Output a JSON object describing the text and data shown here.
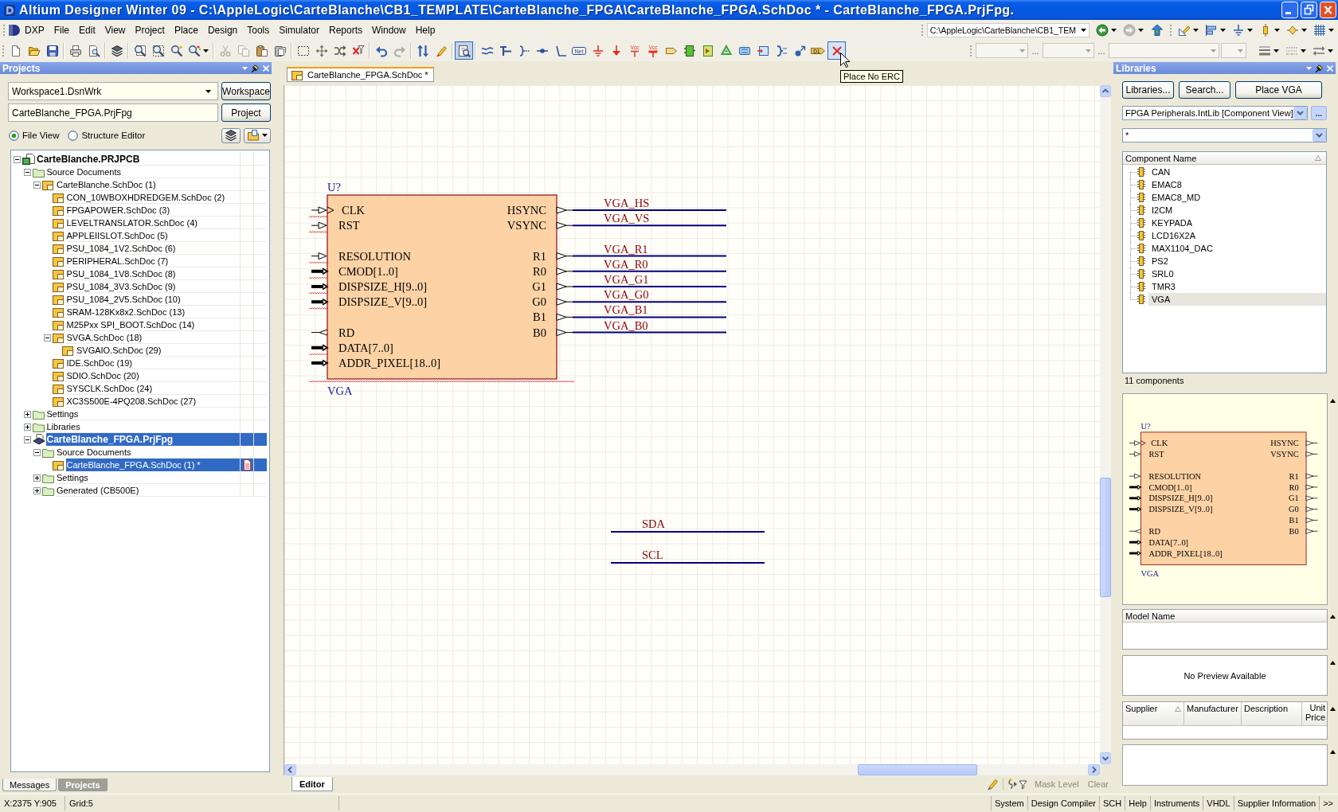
{
  "window": {
    "title": "Altium Designer Winter 09 - C:\\AppleLogic\\CarteBlanche\\CB1_TEMPLATE\\CarteBlanche_FPGA\\CarteBlanche_FPGA.SchDoc * - CarteBlanche_FPGA.PrjFpg."
  },
  "menu": {
    "items": [
      "DXP",
      "File",
      "Edit",
      "View",
      "Project",
      "Place",
      "Design",
      "Tools",
      "Simulator",
      "Reports",
      "Window",
      "Help"
    ],
    "path": "C:\\AppleLogic\\CarteBlanche\\CB1_TEM",
    "navigation": [
      {
        "kind": "back"
      },
      {
        "kind": "forward",
        "disabled": true
      },
      {
        "kind": "up"
      }
    ],
    "tools": [
      {
        "kind": "ruler"
      },
      {
        "kind": "align"
      },
      {
        "kind": "gnd"
      },
      {
        "kind": "resistor"
      },
      {
        "kind": "diamond"
      },
      {
        "kind": "grid"
      }
    ]
  },
  "toolbar": {
    "groups": [
      [
        {
          "kind": "new"
        },
        {
          "kind": "open"
        },
        {
          "kind": "save"
        }
      ],
      [
        {
          "kind": "print"
        },
        {
          "kind": "preview"
        }
      ],
      [
        {
          "kind": "layers"
        }
      ],
      [
        {
          "kind": "zoomfit"
        },
        {
          "kind": "zoomarea"
        },
        {
          "kind": "zoomselect"
        },
        {
          "kind": "zoomfilter"
        }
      ],
      [
        {
          "kind": "cut",
          "disabled": true
        },
        {
          "kind": "copy",
          "disabled": true
        },
        {
          "kind": "paste"
        },
        {
          "kind": "stamp"
        }
      ],
      [
        {
          "kind": "select"
        },
        {
          "kind": "move"
        },
        {
          "kind": "drag"
        },
        {
          "kind": "clearfilter"
        }
      ],
      [
        {
          "kind": "undo"
        },
        {
          "kind": "redo",
          "disabled": true
        }
      ],
      [
        {
          "kind": "updown"
        },
        {
          "kind": "marker"
        }
      ],
      [
        {
          "kind": "crossprobe",
          "pressed": true
        }
      ],
      [
        {
          "kind": "wire"
        },
        {
          "kind": "bus"
        },
        {
          "kind": "busentry"
        },
        {
          "kind": "junction"
        },
        {
          "kind": "bent"
        },
        {
          "kind": "netlabel",
          "text": "Net"
        },
        {
          "kind": "ground"
        },
        {
          "kind": "power"
        },
        {
          "kind": "vcc",
          "text": "Vcc"
        },
        {
          "kind": "vccbar",
          "text": "Vcc"
        },
        {
          "kind": "port"
        },
        {
          "kind": "sheet"
        },
        {
          "kind": "sheetentry"
        },
        {
          "kind": "devicesheet"
        },
        {
          "kind": "harnessconn"
        },
        {
          "kind": "harnessentry"
        },
        {
          "kind": "bracket"
        },
        {
          "kind": "sigharness"
        },
        {
          "kind": "part",
          "text": "D1"
        },
        {
          "kind": "noerc",
          "hovered": true
        }
      ]
    ],
    "format": [
      {
        "kind": "combo"
      },
      {
        "kind": "dots",
        "text": "..."
      },
      {
        "kind": "combo"
      },
      {
        "kind": "dots",
        "text": "..."
      },
      {
        "kind": "combo"
      },
      {
        "kind": "combo"
      }
    ],
    "format_tools": [
      {
        "kind": "linewidth"
      },
      {
        "kind": "linestyle"
      },
      {
        "kind": "arrows"
      }
    ]
  },
  "tooltip": {
    "text": "Place No ERC"
  },
  "projects_panel": {
    "title": "Projects",
    "workspace": "Workspace1.DsnWrk",
    "workspace_button": "Workspace",
    "project": "CarteBlanche_FPGA.PrjFpg",
    "project_button": "Project",
    "views": [
      {
        "label": "File View",
        "selected": true
      },
      {
        "label": "Structure Editor",
        "selected": false
      }
    ],
    "tree": [
      {
        "label": "CarteBlanche.PRJPCB",
        "kind": "pcbproject",
        "expanded": true,
        "selected": false,
        "children": [
          {
            "label": "Source Documents",
            "kind": "folder",
            "expanded": true,
            "selected": false,
            "children": [
              {
                "label": "CarteBlanche.SchDoc (1)",
                "kind": "schdoc",
                "expanded": true,
                "selected": false,
                "children": [
                  {
                    "label": "CON_10WBOXHDREDGEM.SchDoc (2)",
                    "kind": "schdoc",
                    "selected": false
                  },
                  {
                    "label": "FPGAPOWER.SchDoc (3)",
                    "kind": "schdoc",
                    "selected": false
                  },
                  {
                    "label": "LEVELTRANSLATOR.SchDoc (4)",
                    "kind": "schdoc",
                    "selected": false
                  },
                  {
                    "label": "APPLEIISLOT.SchDoc (5)",
                    "kind": "schdoc",
                    "selected": false
                  },
                  {
                    "label": "PSU_1084_1V2.SchDoc (6)",
                    "kind": "schdoc",
                    "selected": false
                  },
                  {
                    "label": "PERIPHERAL.SchDoc (7)",
                    "kind": "schdoc",
                    "selected": false
                  },
                  {
                    "label": "PSU_1084_1V8.SchDoc (8)",
                    "kind": "schdoc",
                    "selected": false
                  },
                  {
                    "label": "PSU_1084_3V3.SchDoc (9)",
                    "kind": "schdoc",
                    "selected": false
                  },
                  {
                    "label": "PSU_1084_2V5.SchDoc (10)",
                    "kind": "schdoc",
                    "selected": false
                  },
                  {
                    "label": "SRAM-128Kx8x2.SchDoc (13)",
                    "kind": "schdoc",
                    "selected": false
                  },
                  {
                    "label": "M25Pxx SPI_BOOT.SchDoc (14)",
                    "kind": "schdoc",
                    "selected": false
                  },
                  {
                    "label": "SVGA.SchDoc (18)",
                    "kind": "schdoc",
                    "expanded": true,
                    "selected": false,
                    "children": [
                      {
                        "label": "SVGAIO.SchDoc (29)",
                        "kind": "schdoc",
                        "selected": false
                      }
                    ]
                  },
                  {
                    "label": "IDE.SchDoc (19)",
                    "kind": "schdoc",
                    "selected": false
                  },
                  {
                    "label": "SDIO.SchDoc (20)",
                    "kind": "schdoc",
                    "selected": false
                  },
                  {
                    "label": "SYSCLK.SchDoc (24)",
                    "kind": "schdoc",
                    "selected": false
                  },
                  {
                    "label": "XC3S500E-4PQ208.SchDoc (27)",
                    "kind": "schdoc",
                    "selected": false
                  }
                ]
              }
            ]
          },
          {
            "label": "Settings",
            "kind": "folder",
            "expanded": false,
            "selected": false
          },
          {
            "label": "Libraries",
            "kind": "folder",
            "expanded": false,
            "selected": false
          },
          {
            "label": "CarteBlanche_FPGA.PrjFpg",
            "kind": "fpgaproject",
            "expanded": true,
            "selected": true,
            "children": [
              {
                "label": "Source Documents",
                "kind": "folder",
                "expanded": true,
                "selected": false,
                "children": [
                  {
                    "label": "CarteBlanche_FPGA.SchDoc (1) *",
                    "kind": "schdoc",
                    "selected": true,
                    "modified": true
                  }
                ]
              },
              {
                "label": "Settings",
                "kind": "folder",
                "expanded": false,
                "selected": false
              },
              {
                "label": "Generated (CB500E)",
                "kind": "folder",
                "expanded": false,
                "selected": false
              }
            ]
          }
        ]
      }
    ],
    "tabs": [
      {
        "label": "Messages",
        "selected": false
      },
      {
        "label": "Projects",
        "selected": true
      }
    ]
  },
  "document": {
    "tabs": [
      {
        "label": "CarteBlanche_FPGA.SchDoc *",
        "selected": true
      }
    ],
    "editor_tabs": [
      {
        "label": "Editor",
        "selected": true
      }
    ],
    "mask_buttons": [
      {
        "label": "Mask Level",
        "disabled": true
      },
      {
        "label": "Clear",
        "disabled": true
      }
    ]
  },
  "schematic": {
    "symbol": {
      "designator": "U?",
      "comment": "VGA",
      "error": true,
      "left_groups": [
        [
          {
            "name": "CLK",
            "kind": "clock",
            "error": true
          },
          {
            "name": "RST",
            "kind": "input",
            "error": true
          }
        ],
        [
          {
            "name": "RESOLUTION",
            "kind": "input",
            "error": true
          },
          {
            "name": "CMOD[1..0]",
            "kind": "bus",
            "error": true
          },
          {
            "name": "DISPSIZE_H[9..0]",
            "kind": "bus",
            "error": true
          },
          {
            "name": "DISPSIZE_V[9..0]",
            "kind": "bus",
            "error": true
          }
        ],
        [
          {
            "name": "RD",
            "kind": "output"
          },
          {
            "name": "DATA[7..0]",
            "kind": "bus",
            "error": true
          },
          {
            "name": "ADDR_PIXEL[18..0]",
            "kind": "bus"
          }
        ]
      ],
      "right_groups": [
        [
          {
            "name": "HSYNC",
            "kind": "output",
            "net": "VGA_HS"
          },
          {
            "name": "VSYNC",
            "kind": "output",
            "net": "VGA_VS"
          }
        ],
        [
          {
            "name": "R1",
            "kind": "output",
            "net": "VGA_R1"
          },
          {
            "name": "R0",
            "kind": "output",
            "net": "VGA_R0"
          },
          {
            "name": "G1",
            "kind": "output",
            "net": "VGA_G1"
          },
          {
            "name": "G0",
            "kind": "output",
            "net": "VGA_G0"
          },
          {
            "name": "B1",
            "kind": "output",
            "net": "VGA_B1"
          },
          {
            "name": "B0",
            "kind": "output",
            "net": "VGA_B0"
          }
        ]
      ]
    },
    "wires": [
      {
        "net": "SDA"
      },
      {
        "net": "SCL"
      }
    ]
  },
  "libraries_panel": {
    "title": "Libraries",
    "buttons": [
      "Libraries...",
      "Search...",
      "Place VGA"
    ],
    "library": "FPGA Peripherals.IntLib [Component View]",
    "more_button": "...",
    "filter": "*",
    "list_header": {
      "label": "Component Name",
      "sorted": true
    },
    "components": [
      {
        "name": "CAN",
        "selected": false
      },
      {
        "name": "EMAC8",
        "selected": false
      },
      {
        "name": "EMAC8_MD",
        "selected": false
      },
      {
        "name": "I2CM",
        "selected": false
      },
      {
        "name": "KEYPADA",
        "selected": false
      },
      {
        "name": "LCD16X2A",
        "selected": false
      },
      {
        "name": "MAX1104_DAC",
        "selected": false
      },
      {
        "name": "PS2",
        "selected": false
      },
      {
        "name": "SRL0",
        "selected": false
      },
      {
        "name": "TMR3",
        "selected": false
      },
      {
        "name": "VGA",
        "selected": true
      }
    ],
    "count": "11 components",
    "preview": {
      "designator": "U?",
      "comment": "VGA",
      "left_groups": [
        [
          {
            "name": "CLK",
            "kind": "clock"
          },
          {
            "name": "RST",
            "kind": "input"
          }
        ],
        [
          {
            "name": "RESOLUTION",
            "kind": "input"
          },
          {
            "name": "CMOD[1..0]",
            "kind": "bus"
          },
          {
            "name": "DISPSIZE_H[9..0]",
            "kind": "bus"
          },
          {
            "name": "DISPSIZE_V[9..0]",
            "kind": "bus"
          }
        ],
        [
          {
            "name": "RD",
            "kind": "output"
          },
          {
            "name": "DATA[7..0]",
            "kind": "bus"
          },
          {
            "name": "ADDR_PIXEL[18..0]",
            "kind": "bus"
          }
        ]
      ],
      "right_groups": [
        [
          {
            "name": "HSYNC",
            "kind": "output"
          },
          {
            "name": "VSYNC",
            "kind": "output"
          }
        ],
        [
          {
            "name": "R1",
            "kind": "output"
          },
          {
            "name": "R0",
            "kind": "output"
          },
          {
            "name": "G1",
            "kind": "output"
          },
          {
            "name": "G0",
            "kind": "output"
          },
          {
            "name": "B1",
            "kind": "output"
          },
          {
            "name": "B0",
            "kind": "output"
          }
        ]
      ]
    },
    "model_header": "Model Name",
    "no_preview": "No Preview Available",
    "supplier_columns": [
      {
        "label": "Supplier",
        "sorted": true
      },
      {
        "label": "Manufacturer",
        "sorted": false
      },
      {
        "label": "Description",
        "sorted": false
      },
      {
        "label": "Unit Price",
        "sorted": false
      }
    ]
  },
  "status_bar": {
    "position": "X:2375 Y:905",
    "grid": "Grid:5",
    "buttons": [
      "System",
      "Design Compiler",
      "SCH",
      "Help",
      "Instruments",
      "VHDL",
      "Supplier Information",
      ">>"
    ]
  }
}
